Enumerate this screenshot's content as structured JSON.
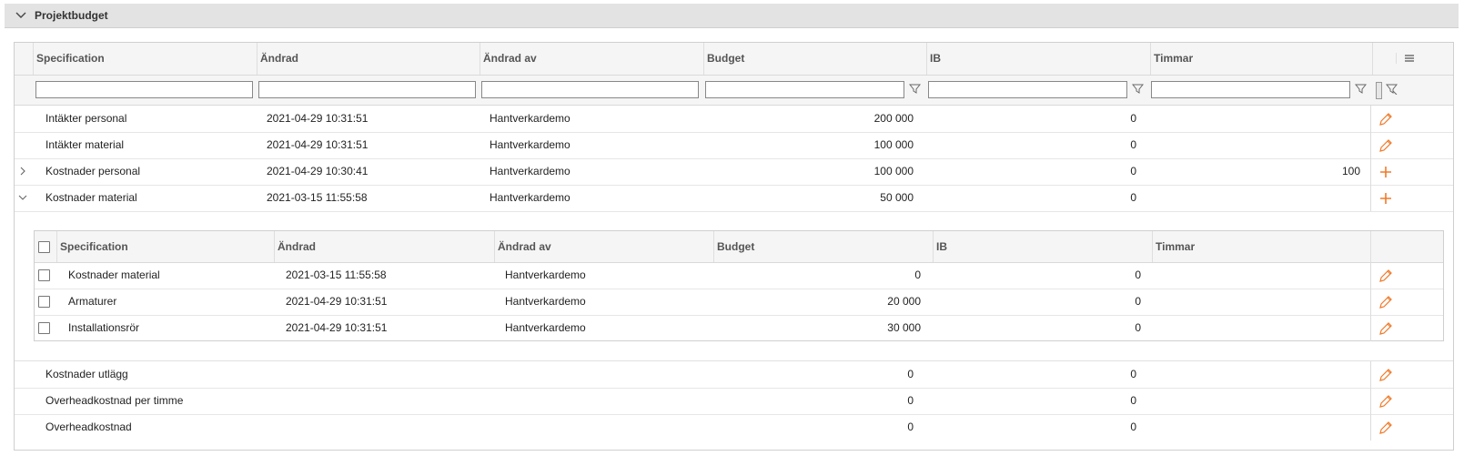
{
  "panel": {
    "title": "Projektbudget"
  },
  "columns": [
    "Specification",
    "Ändrad",
    "Ändrad av",
    "Budget",
    "IB",
    "Timmar"
  ],
  "rows": [
    {
      "spec": "Intäkter personal",
      "changed": "2021-04-29 10:31:51",
      "by": "Hantverkardemo",
      "budget": "200 000",
      "ib": "0",
      "timmar": "",
      "action": "edit"
    },
    {
      "spec": "Intäkter material",
      "changed": "2021-04-29 10:31:51",
      "by": "Hantverkardemo",
      "budget": "100 000",
      "ib": "0",
      "timmar": "",
      "action": "edit"
    },
    {
      "spec": "Kostnader personal",
      "changed": "2021-04-29 10:30:41",
      "by": "Hantverkardemo",
      "budget": "100 000",
      "ib": "0",
      "timmar": "100",
      "action": "add"
    },
    {
      "spec": "Kostnader material",
      "changed": "2021-03-15 11:55:58",
      "by": "Hantverkardemo",
      "budget": "50 000",
      "ib": "0",
      "timmar": "",
      "action": "add"
    }
  ],
  "subgrid": {
    "columns": [
      "Specification",
      "Ändrad",
      "Ändrad av",
      "Budget",
      "IB",
      "Timmar"
    ],
    "rows": [
      {
        "spec": "Kostnader material",
        "changed": "2021-03-15 11:55:58",
        "by": "Hantverkardemo",
        "budget": "0",
        "ib": "0"
      },
      {
        "spec": "Armaturer",
        "changed": "2021-04-29 10:31:51",
        "by": "Hantverkardemo",
        "budget": "20 000",
        "ib": "0"
      },
      {
        "spec": "Installationsrör",
        "changed": "2021-04-29 10:31:51",
        "by": "Hantverkardemo",
        "budget": "30 000",
        "ib": "0"
      }
    ]
  },
  "rows_after": [
    {
      "spec": "Kostnader utlägg",
      "budget": "0",
      "ib": "0"
    },
    {
      "spec": "Overheadkostnad per timme",
      "budget": "0",
      "ib": "0"
    },
    {
      "spec": "Overheadkostnad",
      "budget": "0",
      "ib": "0"
    }
  ],
  "colors": {
    "accent": "#f07a2a",
    "header_bg": "#e3e3e3",
    "grid_header_bg": "#f5f5f5"
  },
  "icons": {
    "collapse": "chevron-down-icon",
    "expand": "chevron-right-icon",
    "edit": "pencil-icon",
    "add": "plus-icon",
    "filter": "funnel-icon",
    "menu": "hamburger-menu-icon"
  }
}
